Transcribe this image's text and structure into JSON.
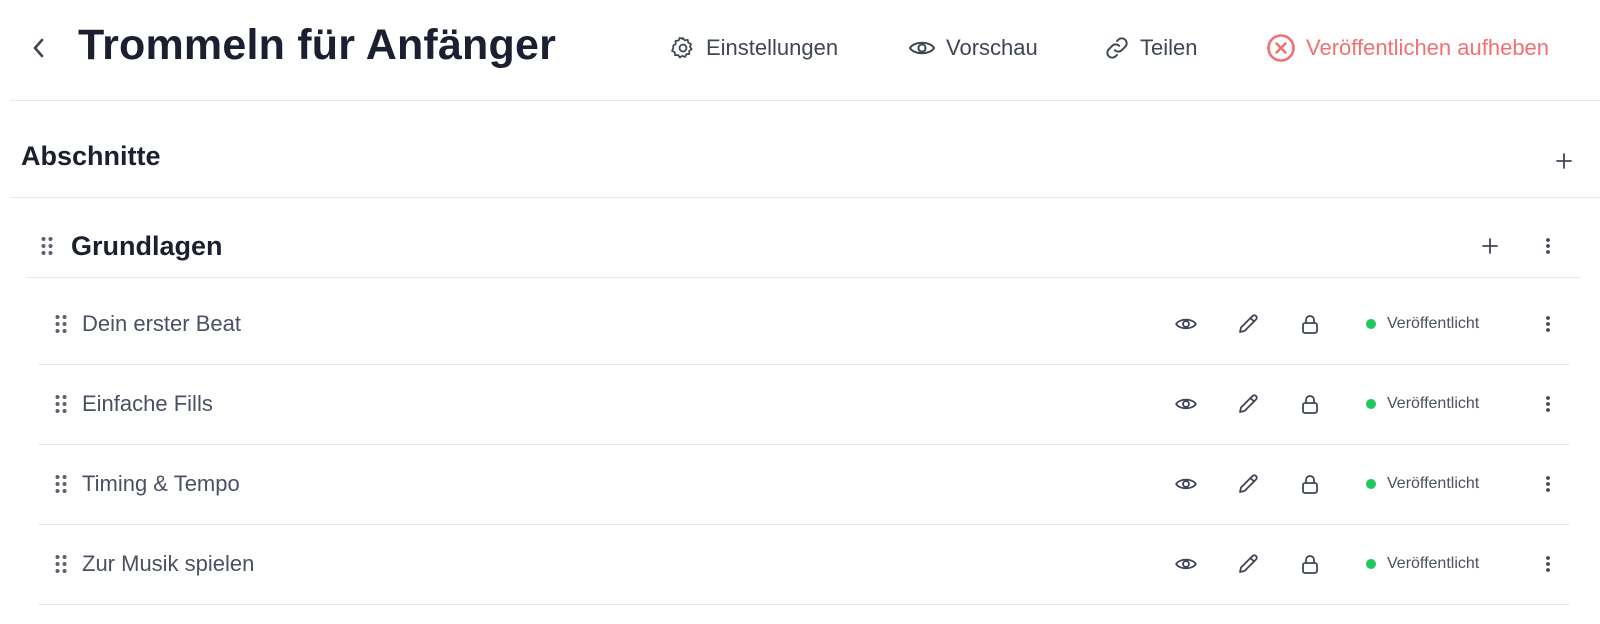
{
  "header": {
    "title": "Trommeln für Anfänger",
    "back_icon": "chevron-left-icon",
    "actions": [
      {
        "label": "Einstellungen",
        "icon": "gear-icon"
      },
      {
        "label": "Vorschau",
        "icon": "eye-icon"
      },
      {
        "label": "Teilen",
        "icon": "link-icon"
      },
      {
        "label": "Veröffentlichen aufheben",
        "icon": "x-circle-icon",
        "color": "#f07171"
      }
    ]
  },
  "sections": {
    "title": "Abschnitte",
    "add_icon": "plus-icon",
    "groups": [
      {
        "title": "Grundlagen",
        "lessons": [
          {
            "title": "Dein erster Beat",
            "status": "Veröffentlicht"
          },
          {
            "title": "Einfache Fills",
            "status": "Veröffentlicht"
          },
          {
            "title": "Timing & Tempo",
            "status": "Veröffentlicht"
          },
          {
            "title": "Zur Musik spielen",
            "status": "Veröffentlicht"
          }
        ]
      }
    ]
  },
  "colors": {
    "accent_danger": "#f07171",
    "status_published": "#22c55e",
    "text_primary": "#1b2030",
    "text_secondary": "#4a5162",
    "divider": "#e6e8ec"
  }
}
